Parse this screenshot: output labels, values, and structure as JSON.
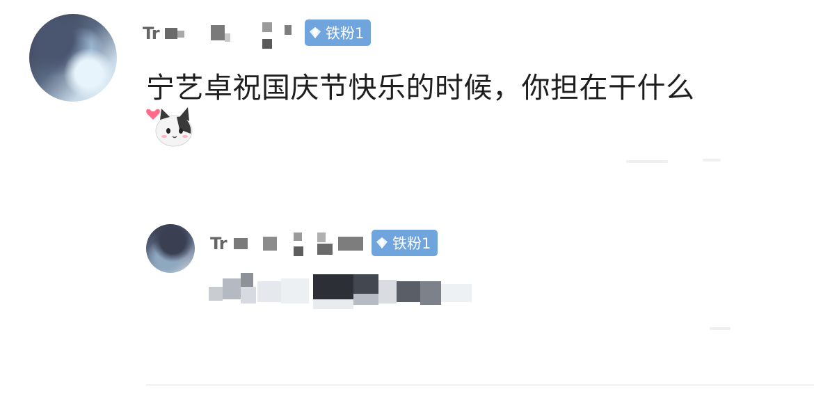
{
  "comment": {
    "user": {
      "name_prefix": "Tr",
      "badge_label": "铁粉1"
    },
    "text": "宁艺卓祝国庆节快乐的时候，你担在干什么",
    "emoji": "cat-heart-emoji"
  },
  "reply": {
    "user": {
      "name_prefix": "Tr",
      "badge_label": "铁粉1"
    }
  },
  "colors": {
    "badge_bg": "#6fa5dc",
    "text": "#1e1e1e",
    "username": "#666666"
  }
}
